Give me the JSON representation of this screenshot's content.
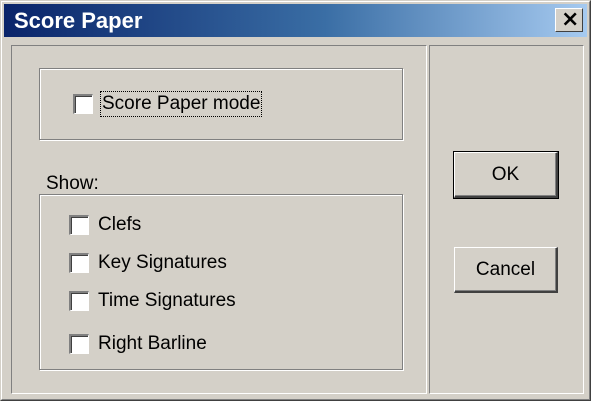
{
  "window": {
    "title": "Score Paper",
    "close_glyph": "×"
  },
  "mode": {
    "checkbox_label": "Score Paper mode",
    "checked": false
  },
  "show": {
    "label": "Show:",
    "items": [
      {
        "label": "Clefs",
        "checked": false
      },
      {
        "label": "Key Signatures",
        "checked": false
      },
      {
        "label": "Time Signatures",
        "checked": false
      },
      {
        "label": "Right Barline",
        "checked": false
      }
    ]
  },
  "buttons": {
    "ok": "OK",
    "cancel": "Cancel"
  },
  "colors": {
    "titlebar_start": "#0a246a",
    "titlebar_end": "#a6caf0",
    "face": "#d4d0c8"
  }
}
